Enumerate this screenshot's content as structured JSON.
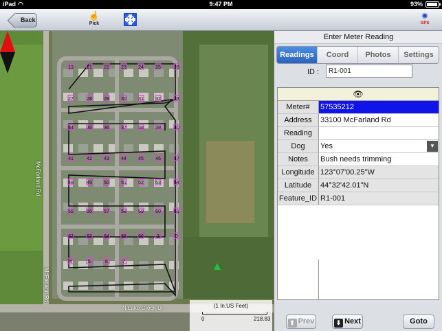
{
  "status_bar": {
    "carrier": "iPad",
    "time": "9:47 PM",
    "battery": "93%",
    "battery_level": 0.93
  },
  "toolbar": {
    "back_label": "Back",
    "pick_label": "Pick",
    "gps_label": "GPS",
    "icons": {
      "pick": "hand-pointer-icon",
      "fit": "zoom-extent-icon",
      "gps": "satellite-icon"
    }
  },
  "map": {
    "streets": [
      "McFarland Rd",
      "McFarland Rd",
      "N Lake Creek Dr"
    ],
    "scale_unit": "(1 In:US Feet)",
    "scale_min": "0",
    "scale_max": "218.83",
    "meter_labels": [
      "13",
      "21",
      "22",
      "23",
      "24",
      "25",
      "26",
      "27",
      "28",
      "29",
      "30",
      "31",
      "32",
      "33",
      "34",
      "35",
      "36",
      "37",
      "38",
      "39",
      "40",
      "41",
      "42",
      "43",
      "44",
      "45",
      "46",
      "47",
      "48",
      "49",
      "50",
      "51",
      "52",
      "53",
      "54",
      "55",
      "56",
      "57",
      "58",
      "59",
      "60",
      "61",
      "62",
      "63",
      "64",
      "65",
      "66",
      "2",
      "3",
      "4",
      "5",
      "6",
      "7"
    ]
  },
  "panel": {
    "title": "Enter Meter Reading",
    "tabs": [
      "Readings",
      "Coord",
      "Photos",
      "Settings"
    ],
    "active_tab": "Readings",
    "id_label": "ID :",
    "id_value": "R1-001",
    "header_icon": "eye-icon",
    "header_glyph": "👁",
    "rows": [
      {
        "key": "Meter#",
        "value": "57535212"
      },
      {
        "key": "Address",
        "value": "33100 McFarland Rd"
      },
      {
        "key": "Reading",
        "value": ""
      },
      {
        "key": "Dog",
        "value": "Yes",
        "dropdown_glyph": "▼"
      },
      {
        "key": "Notes",
        "value": "Bush needs trimming"
      },
      {
        "key": "Longitude",
        "value": "123°07'00.25\"W"
      },
      {
        "key": "Latitude",
        "value": "44°32'42.01\"N"
      },
      {
        "key": "Feature_ID",
        "value": "R1-001"
      }
    ],
    "buttons": {
      "prev": "Prev",
      "next": "Next",
      "goto": "Goto"
    }
  },
  "colors": {
    "selected_row": "#1014e8",
    "active_tab": "#2a62c4",
    "meter_marker": "#e040e0"
  }
}
